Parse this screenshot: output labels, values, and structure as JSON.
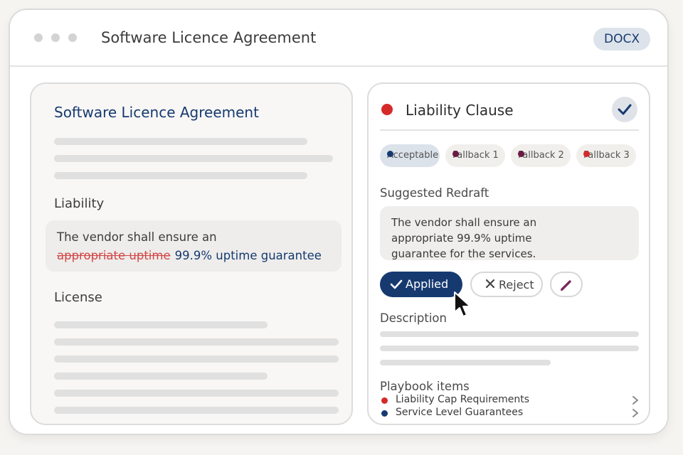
{
  "window": {
    "title": "Software Licence Agreement",
    "format_badge": "DOCX"
  },
  "document": {
    "title": "Software Licence Agreement",
    "liability_heading": "Liability",
    "clause_text_prefix": "The vendor shall ensure an",
    "clause_deleted": "appropriate uptime",
    "clause_inserted": "99.9% uptime guarantee",
    "license_heading": "License"
  },
  "review": {
    "clause_title": "Liability Clause",
    "status_color": "#d42a2a",
    "options": [
      {
        "label": "Acceptable",
        "dot_color": "#163a70",
        "active": true
      },
      {
        "label": "Fallback 1",
        "dot_color": "#6b1a45",
        "active": false
      },
      {
        "label": "Fallback 2",
        "dot_color": "#6b1a45",
        "active": false
      },
      {
        "label": "Fallback 3",
        "dot_color": "#d42a2a",
        "active": false
      }
    ],
    "redraft_label": "Suggested Redraft",
    "redraft_text": "The vendor shall ensure an appropriate 99.9% uptime guarantee for the services.",
    "applied_label": "Applied",
    "reject_label": "Reject",
    "description_label": "Description",
    "playbook_label": "Playbook items",
    "playbook_items": [
      {
        "label": "Liability Cap Requirements",
        "dot_color": "#d42a2a"
      },
      {
        "label": "Service Level Guarantees",
        "dot_color": "#163a70"
      }
    ]
  },
  "colors": {
    "accent": "#163a70",
    "danger": "#d42a2a",
    "deleted_text": "#d34545"
  },
  "icons": {
    "check": "check-icon",
    "close": "close-icon",
    "edit": "pencil-icon",
    "chevron": "chevron-right-icon",
    "cursor": "mouse-cursor-icon"
  }
}
